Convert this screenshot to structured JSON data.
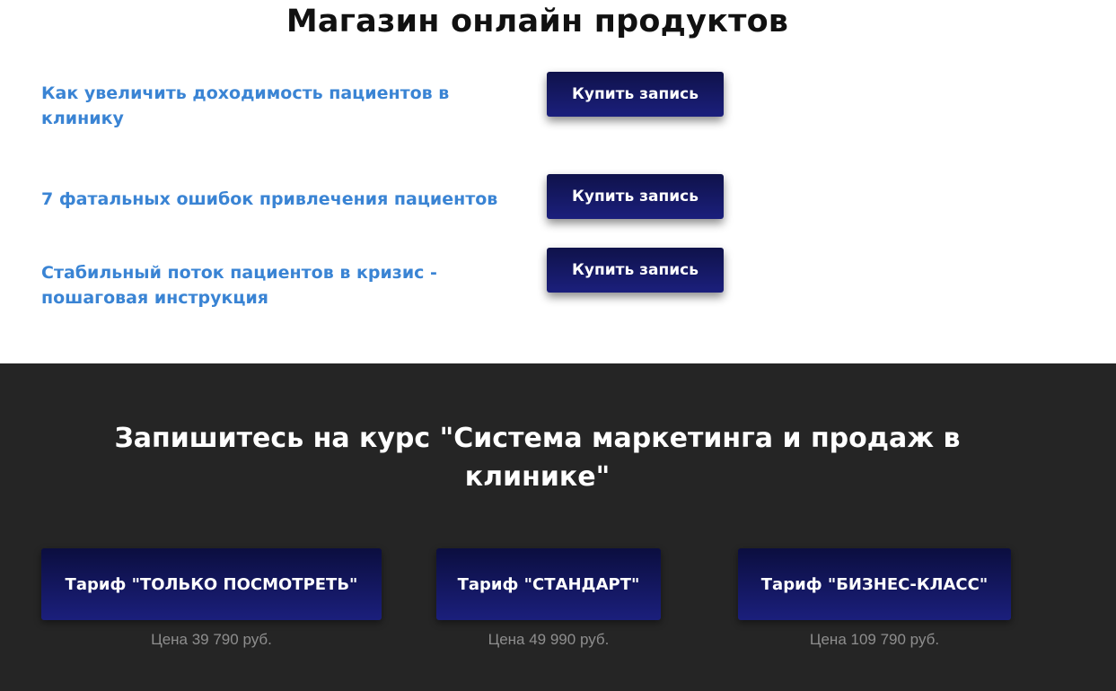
{
  "shop": {
    "title": "Магазин онлайн продуктов",
    "products": [
      {
        "title": "Как увеличить доходимость пациентов в клинику",
        "button_label": "Купить запись"
      },
      {
        "title": "7 фатальных ошибок привлечения пациентов",
        "button_label": "Купить запись"
      },
      {
        "title": "Стабильный поток пациентов в кризис - пошаговая инструкция",
        "button_label": "Купить запись"
      }
    ]
  },
  "course": {
    "heading": "Запишитесь на курс \"Система маркетинга и продаж в клинике\"",
    "tariffs": [
      {
        "label": "Тариф \"ТОЛЬКО ПОСМОТРЕТЬ\"",
        "price": "Цена 39 790 руб."
      },
      {
        "label": "Тариф \"СТАНДАРТ\"",
        "price": "Цена 49 990 руб."
      },
      {
        "label": "Тариф \"БИЗНЕС-КЛАСС\"",
        "price": "Цена 109 790 руб."
      }
    ]
  },
  "colors": {
    "product_link": "#3a84d4",
    "button_dark": "#0f124a",
    "button_light": "#1b1f7c",
    "dark_section": "#252525",
    "price_text": "#8e8e8e"
  }
}
